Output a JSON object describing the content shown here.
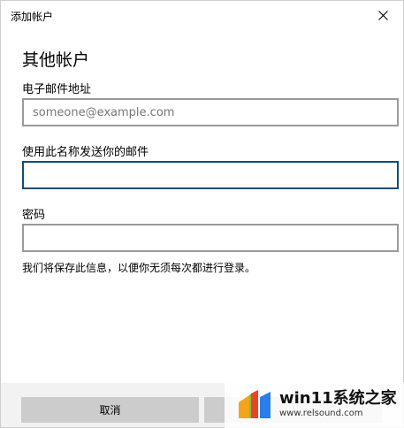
{
  "window": {
    "title": "添加帐户",
    "close_icon": "close-icon"
  },
  "form": {
    "heading": "其他帐户",
    "email_label": "电子邮件地址",
    "email_value": "",
    "email_placeholder": "someone@example.com",
    "name_label": "使用此名称发送你的邮件",
    "name_value": "",
    "password_label": "密码",
    "password_value": "",
    "note": "我们将保存此信息，以便你无须每次都进行登录。"
  },
  "footer": {
    "cancel_label": "取消",
    "next_label": ""
  },
  "watermark": {
    "title": "win11系统之家",
    "url": "www.relsound.com",
    "logo_icon": "windows-logo-icon"
  },
  "colors": {
    "focus_border": "#0d4f7a",
    "input_border": "#9a9a9a",
    "button_bg": "#cccccc",
    "footer_bg": "#f2f2f2"
  }
}
